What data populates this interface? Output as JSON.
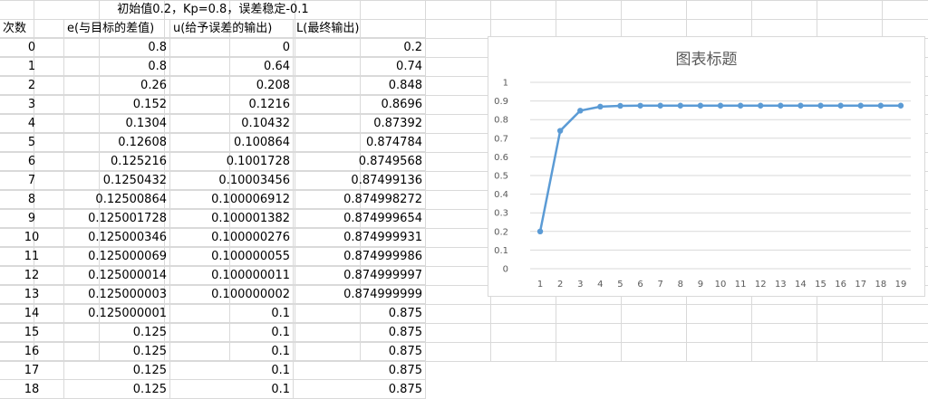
{
  "sheet": {
    "title": "初始值0.2，Kp=0.8，误差稳定-0.1",
    "headers": [
      "次数",
      "e(与目标的差值)",
      "u(给予误差的输出)",
      "L(最终输出)"
    ],
    "rows": [
      [
        "0",
        "0.8",
        "0",
        "0.2"
      ],
      [
        "1",
        "0.8",
        "0.64",
        "0.74"
      ],
      [
        "2",
        "0.26",
        "0.208",
        "0.848"
      ],
      [
        "3",
        "0.152",
        "0.1216",
        "0.8696"
      ],
      [
        "4",
        "0.1304",
        "0.10432",
        "0.87392"
      ],
      [
        "5",
        "0.12608",
        "0.100864",
        "0.874784"
      ],
      [
        "6",
        "0.125216",
        "0.1001728",
        "0.8749568"
      ],
      [
        "7",
        "0.1250432",
        "0.10003456",
        "0.87499136"
      ],
      [
        "8",
        "0.12500864",
        "0.100006912",
        "0.874998272"
      ],
      [
        "9",
        "0.125001728",
        "0.100001382",
        "0.874999654"
      ],
      [
        "10",
        "0.125000346",
        "0.100000276",
        "0.874999931"
      ],
      [
        "11",
        "0.125000069",
        "0.100000055",
        "0.874999986"
      ],
      [
        "12",
        "0.125000014",
        "0.100000011",
        "0.874999997"
      ],
      [
        "13",
        "0.125000003",
        "0.100000002",
        "0.874999999"
      ],
      [
        "14",
        "0.125000001",
        "0.1",
        "0.875"
      ],
      [
        "15",
        "0.125",
        "0.1",
        "0.875"
      ],
      [
        "16",
        "0.125",
        "0.1",
        "0.875"
      ],
      [
        "17",
        "0.125",
        "0.1",
        "0.875"
      ],
      [
        "18",
        "0.125",
        "0.1",
        "0.875"
      ]
    ]
  },
  "chart_data": {
    "type": "line",
    "title": "图表标题",
    "categories": [
      "1",
      "2",
      "3",
      "4",
      "5",
      "6",
      "7",
      "8",
      "9",
      "10",
      "11",
      "12",
      "13",
      "14",
      "15",
      "16",
      "17",
      "18",
      "19"
    ],
    "series": [
      {
        "values": [
          0.2,
          0.74,
          0.848,
          0.8696,
          0.87392,
          0.874784,
          0.8749568,
          0.87499136,
          0.874998272,
          0.874999654,
          0.874999931,
          0.874999986,
          0.874999997,
          0.874999999,
          0.875,
          0.875,
          0.875,
          0.875,
          0.875
        ]
      }
    ],
    "ylim": [
      0,
      1
    ],
    "yticks": [
      "0",
      "0.1",
      "0.2",
      "0.3",
      "0.4",
      "0.5",
      "0.6",
      "0.7",
      "0.8",
      "0.9",
      "1"
    ],
    "grid": true,
    "colors": {
      "line": "#5b9bd5",
      "grid": "#d9d9d9",
      "text": "#595959"
    }
  }
}
